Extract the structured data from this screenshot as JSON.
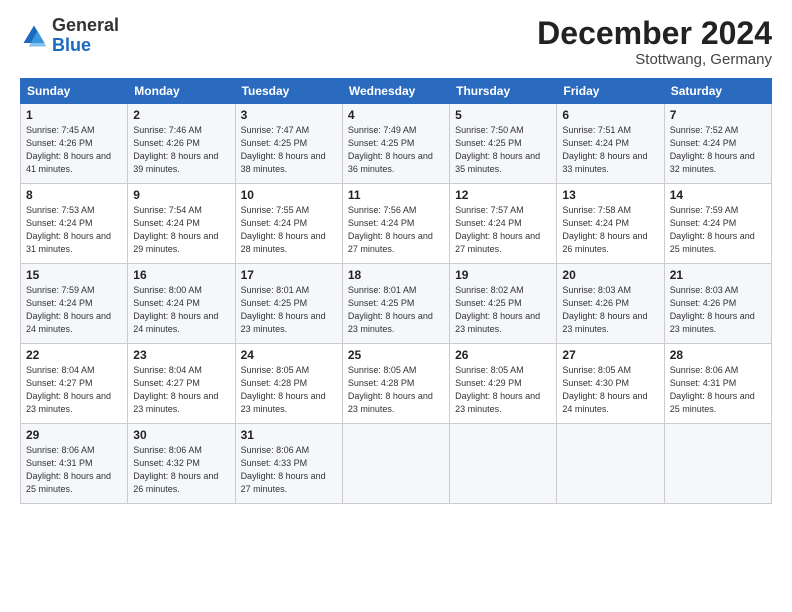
{
  "logo": {
    "general": "General",
    "blue": "Blue"
  },
  "header": {
    "title": "December 2024",
    "subtitle": "Stottwang, Germany"
  },
  "weekdays": [
    "Sunday",
    "Monday",
    "Tuesday",
    "Wednesday",
    "Thursday",
    "Friday",
    "Saturday"
  ],
  "weeks": [
    [
      {
        "day": "1",
        "sunrise": "Sunrise: 7:45 AM",
        "sunset": "Sunset: 4:26 PM",
        "daylight": "Daylight: 8 hours and 41 minutes."
      },
      {
        "day": "2",
        "sunrise": "Sunrise: 7:46 AM",
        "sunset": "Sunset: 4:26 PM",
        "daylight": "Daylight: 8 hours and 39 minutes."
      },
      {
        "day": "3",
        "sunrise": "Sunrise: 7:47 AM",
        "sunset": "Sunset: 4:25 PM",
        "daylight": "Daylight: 8 hours and 38 minutes."
      },
      {
        "day": "4",
        "sunrise": "Sunrise: 7:49 AM",
        "sunset": "Sunset: 4:25 PM",
        "daylight": "Daylight: 8 hours and 36 minutes."
      },
      {
        "day": "5",
        "sunrise": "Sunrise: 7:50 AM",
        "sunset": "Sunset: 4:25 PM",
        "daylight": "Daylight: 8 hours and 35 minutes."
      },
      {
        "day": "6",
        "sunrise": "Sunrise: 7:51 AM",
        "sunset": "Sunset: 4:24 PM",
        "daylight": "Daylight: 8 hours and 33 minutes."
      },
      {
        "day": "7",
        "sunrise": "Sunrise: 7:52 AM",
        "sunset": "Sunset: 4:24 PM",
        "daylight": "Daylight: 8 hours and 32 minutes."
      }
    ],
    [
      {
        "day": "8",
        "sunrise": "Sunrise: 7:53 AM",
        "sunset": "Sunset: 4:24 PM",
        "daylight": "Daylight: 8 hours and 31 minutes."
      },
      {
        "day": "9",
        "sunrise": "Sunrise: 7:54 AM",
        "sunset": "Sunset: 4:24 PM",
        "daylight": "Daylight: 8 hours and 29 minutes."
      },
      {
        "day": "10",
        "sunrise": "Sunrise: 7:55 AM",
        "sunset": "Sunset: 4:24 PM",
        "daylight": "Daylight: 8 hours and 28 minutes."
      },
      {
        "day": "11",
        "sunrise": "Sunrise: 7:56 AM",
        "sunset": "Sunset: 4:24 PM",
        "daylight": "Daylight: 8 hours and 27 minutes."
      },
      {
        "day": "12",
        "sunrise": "Sunrise: 7:57 AM",
        "sunset": "Sunset: 4:24 PM",
        "daylight": "Daylight: 8 hours and 27 minutes."
      },
      {
        "day": "13",
        "sunrise": "Sunrise: 7:58 AM",
        "sunset": "Sunset: 4:24 PM",
        "daylight": "Daylight: 8 hours and 26 minutes."
      },
      {
        "day": "14",
        "sunrise": "Sunrise: 7:59 AM",
        "sunset": "Sunset: 4:24 PM",
        "daylight": "Daylight: 8 hours and 25 minutes."
      }
    ],
    [
      {
        "day": "15",
        "sunrise": "Sunrise: 7:59 AM",
        "sunset": "Sunset: 4:24 PM",
        "daylight": "Daylight: 8 hours and 24 minutes."
      },
      {
        "day": "16",
        "sunrise": "Sunrise: 8:00 AM",
        "sunset": "Sunset: 4:24 PM",
        "daylight": "Daylight: 8 hours and 24 minutes."
      },
      {
        "day": "17",
        "sunrise": "Sunrise: 8:01 AM",
        "sunset": "Sunset: 4:25 PM",
        "daylight": "Daylight: 8 hours and 23 minutes."
      },
      {
        "day": "18",
        "sunrise": "Sunrise: 8:01 AM",
        "sunset": "Sunset: 4:25 PM",
        "daylight": "Daylight: 8 hours and 23 minutes."
      },
      {
        "day": "19",
        "sunrise": "Sunrise: 8:02 AM",
        "sunset": "Sunset: 4:25 PM",
        "daylight": "Daylight: 8 hours and 23 minutes."
      },
      {
        "day": "20",
        "sunrise": "Sunrise: 8:03 AM",
        "sunset": "Sunset: 4:26 PM",
        "daylight": "Daylight: 8 hours and 23 minutes."
      },
      {
        "day": "21",
        "sunrise": "Sunrise: 8:03 AM",
        "sunset": "Sunset: 4:26 PM",
        "daylight": "Daylight: 8 hours and 23 minutes."
      }
    ],
    [
      {
        "day": "22",
        "sunrise": "Sunrise: 8:04 AM",
        "sunset": "Sunset: 4:27 PM",
        "daylight": "Daylight: 8 hours and 23 minutes."
      },
      {
        "day": "23",
        "sunrise": "Sunrise: 8:04 AM",
        "sunset": "Sunset: 4:27 PM",
        "daylight": "Daylight: 8 hours and 23 minutes."
      },
      {
        "day": "24",
        "sunrise": "Sunrise: 8:05 AM",
        "sunset": "Sunset: 4:28 PM",
        "daylight": "Daylight: 8 hours and 23 minutes."
      },
      {
        "day": "25",
        "sunrise": "Sunrise: 8:05 AM",
        "sunset": "Sunset: 4:28 PM",
        "daylight": "Daylight: 8 hours and 23 minutes."
      },
      {
        "day": "26",
        "sunrise": "Sunrise: 8:05 AM",
        "sunset": "Sunset: 4:29 PM",
        "daylight": "Daylight: 8 hours and 23 minutes."
      },
      {
        "day": "27",
        "sunrise": "Sunrise: 8:05 AM",
        "sunset": "Sunset: 4:30 PM",
        "daylight": "Daylight: 8 hours and 24 minutes."
      },
      {
        "day": "28",
        "sunrise": "Sunrise: 8:06 AM",
        "sunset": "Sunset: 4:31 PM",
        "daylight": "Daylight: 8 hours and 25 minutes."
      }
    ],
    [
      {
        "day": "29",
        "sunrise": "Sunrise: 8:06 AM",
        "sunset": "Sunset: 4:31 PM",
        "daylight": "Daylight: 8 hours and 25 minutes."
      },
      {
        "day": "30",
        "sunrise": "Sunrise: 8:06 AM",
        "sunset": "Sunset: 4:32 PM",
        "daylight": "Daylight: 8 hours and 26 minutes."
      },
      {
        "day": "31",
        "sunrise": "Sunrise: 8:06 AM",
        "sunset": "Sunset: 4:33 PM",
        "daylight": "Daylight: 8 hours and 27 minutes."
      },
      null,
      null,
      null,
      null
    ]
  ]
}
